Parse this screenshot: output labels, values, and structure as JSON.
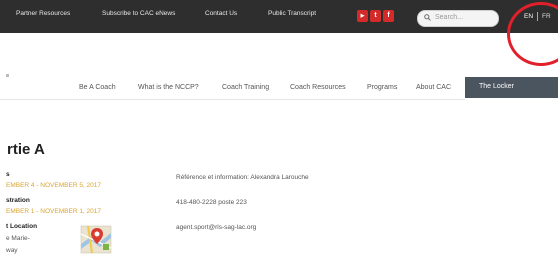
{
  "topbar": {
    "links": [
      "Partner Resources",
      "Subscribe to CAC eNews",
      "Contact Us",
      "Public Transcript"
    ],
    "social": [
      "YouTube",
      "Twitter",
      "Facebook"
    ],
    "search_placeholder": "Search...",
    "languages": [
      "EN",
      "FR"
    ]
  },
  "nav": {
    "items": [
      "Be A Coach",
      "What is the NCCP?",
      "Coach Training",
      "Coach Resources",
      "Programs",
      "About CAC"
    ],
    "locker": "The Locker"
  },
  "page": {
    "title": "rtie A",
    "dates_label": "s",
    "dates": "EMBER 4 - NOVEMBER 5, 2017",
    "registration_label": "stration",
    "registration": "EMBER 1 - NOVEMBER 1, 2017",
    "location_label": "t Location",
    "location_line1": "e Marie-",
    "location_line2": "way",
    "reference": "Référence et information: Alexandra Larouche",
    "phone": "418-480-2228 poste 223",
    "email": "agent.sport@rls-sag-lac.org"
  },
  "colors": {
    "topbar_bg": "#2e2e2e",
    "accent_date": "#d9a531",
    "locker_bg": "#4b555f",
    "annotation_red": "#e0202a"
  }
}
